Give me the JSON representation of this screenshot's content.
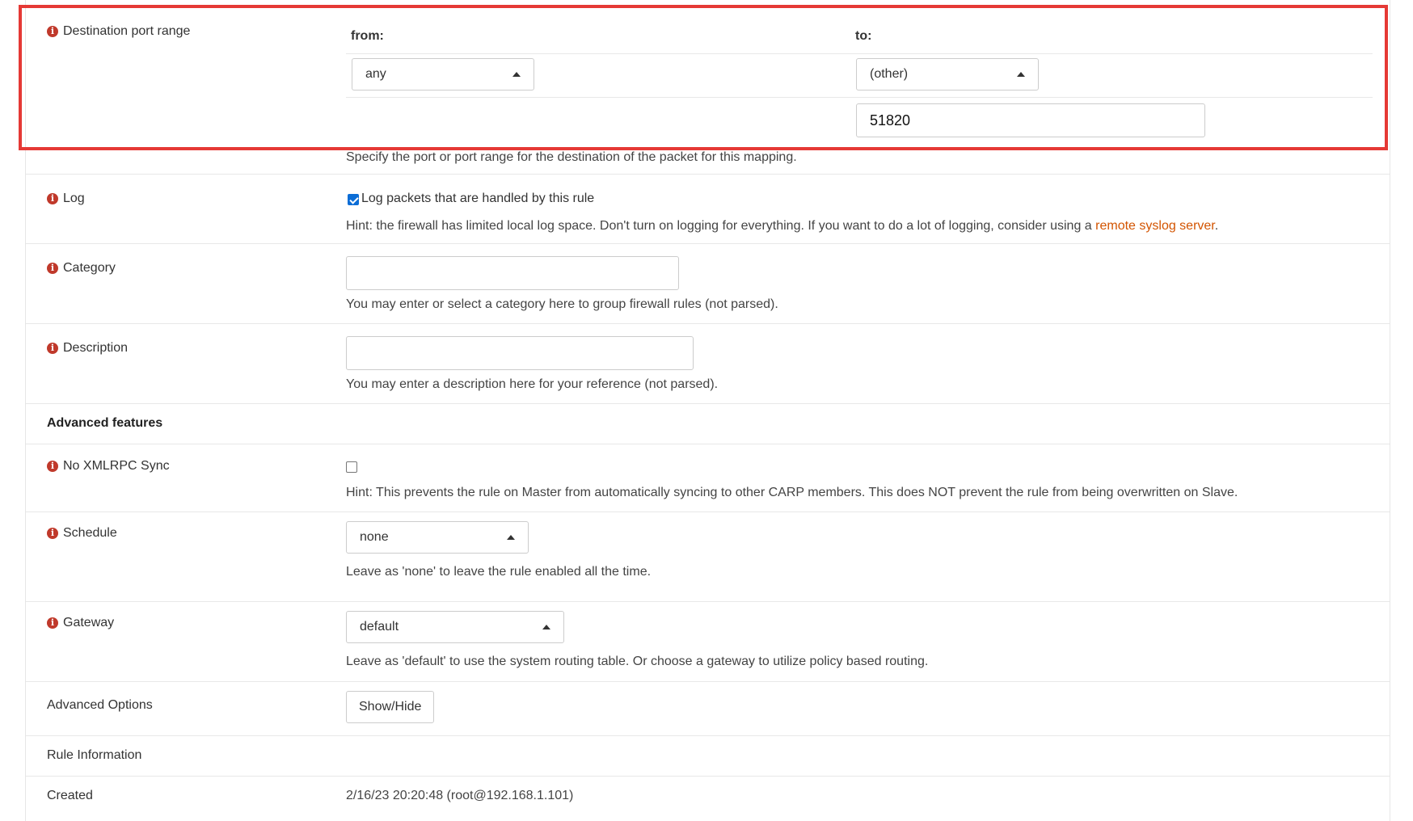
{
  "destination_port": {
    "label": "Destination port range",
    "from_label": "from:",
    "to_label": "to:",
    "from_value": "any",
    "to_value": "(other)",
    "to_port_input": "51820",
    "hint": "Specify the port or port range for the destination of the packet for this mapping."
  },
  "log": {
    "label": "Log",
    "checkbox_label": "Log packets that are handled by this rule",
    "checked": true,
    "hint_prefix": "Hint: the firewall has limited local log space. Don't turn on logging for everything. If you want to do a lot of logging, consider using a ",
    "hint_link": "remote syslog server",
    "hint_suffix": "."
  },
  "category": {
    "label": "Category",
    "value": "",
    "hint": "You may enter or select a category here to group firewall rules (not parsed)."
  },
  "description": {
    "label": "Description",
    "value": "",
    "hint": "You may enter a description here for your reference (not parsed)."
  },
  "advanced_features": {
    "label": "Advanced features"
  },
  "xmlrpc": {
    "label": "No XMLRPC Sync",
    "checked": false,
    "hint": "Hint: This prevents the rule on Master from automatically syncing to other CARP members. This does NOT prevent the rule from being overwritten on Slave."
  },
  "schedule": {
    "label": "Schedule",
    "value": "none",
    "hint": "Leave as 'none' to leave the rule enabled all the time."
  },
  "gateway": {
    "label": "Gateway",
    "value": "default",
    "hint": "Leave as 'default' to use the system routing table. Or choose a gateway to utilize policy based routing."
  },
  "advanced_options": {
    "label": "Advanced Options",
    "button": "Show/Hide"
  },
  "rule_information": {
    "label": "Rule Information"
  },
  "created": {
    "label": "Created",
    "value": "2/16/23 20:20:48 (root@192.168.1.101)"
  },
  "colors": {
    "highlight": "#e53935",
    "link": "#d35400",
    "info_icon": "#c0392b"
  }
}
